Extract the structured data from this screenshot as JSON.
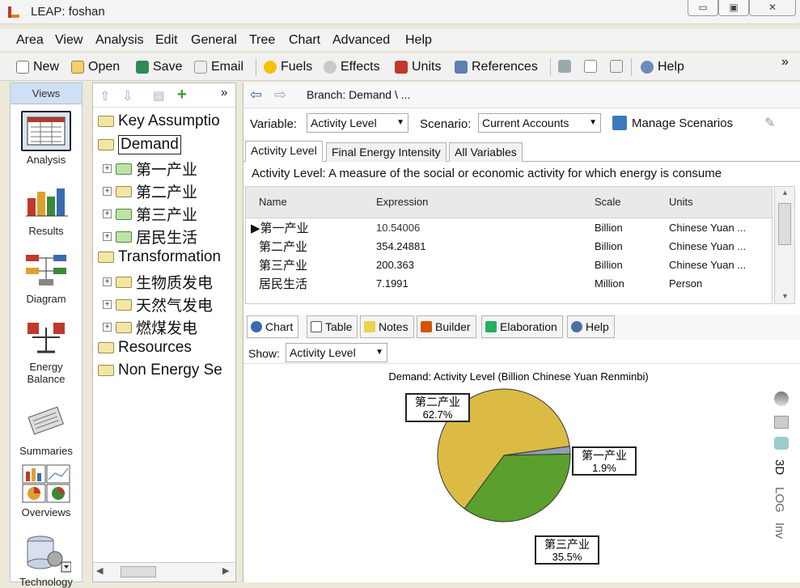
{
  "window": {
    "title": "LEAP: foshan",
    "buttons": [
      "▭",
      "▣",
      "✕"
    ]
  },
  "menu": [
    "Area",
    "View",
    "Analysis",
    "Edit",
    "General",
    "Tree",
    "Chart",
    "Advanced",
    "Help"
  ],
  "toolbar": {
    "new": "New",
    "open": "Open",
    "save": "Save",
    "email": "Email",
    "fuels": "Fuels",
    "effects": "Effects",
    "units": "Units",
    "references": "References",
    "help": "Help",
    "more": "»"
  },
  "views": {
    "header": "Views",
    "items": [
      "Analysis",
      "Results",
      "Diagram",
      "Energy Balance",
      "Summaries",
      "Overviews",
      "Technology"
    ]
  },
  "tree": {
    "more": "»",
    "nodes": [
      {
        "label": "Key Assumptio"
      },
      {
        "label": "Demand"
      },
      {
        "label": "第一产业"
      },
      {
        "label": "第二产业"
      },
      {
        "label": "第三产业"
      },
      {
        "label": "居民生活"
      },
      {
        "label": "Transformation"
      },
      {
        "label": "生物质发电"
      },
      {
        "label": "天然气发电"
      },
      {
        "label": "燃煤发电"
      },
      {
        "label": "Resources"
      },
      {
        "label": "Non Energy Se"
      }
    ]
  },
  "branch": {
    "label": "Branch: Demand \\ ..."
  },
  "variable": {
    "label": "Variable:",
    "value": "Activity Level"
  },
  "scenario": {
    "label": "Scenario:",
    "value": "Current Accounts",
    "manage": "Manage Scenarios"
  },
  "tabs": [
    "Activity Level",
    "Final Energy Intensity",
    "All Variables"
  ],
  "description": "Activity Level: A measure of the social or economic activity for which energy is consume",
  "table": {
    "headers": [
      "Name",
      "Expression",
      "Scale",
      "Units"
    ],
    "rows": [
      [
        "第一产业",
        "10.54006",
        "Billion",
        "Chinese Yuan ..."
      ],
      [
        "第二产业",
        "354.24881",
        "Billion",
        "Chinese Yuan ..."
      ],
      [
        "第三产业",
        "200.363",
        "Billion",
        "Chinese Yuan ..."
      ],
      [
        "居民生活",
        "7.1991",
        "Million",
        "Person"
      ]
    ]
  },
  "bottom_tabs": [
    "Chart",
    "Table",
    "Notes",
    "Builder",
    "Elaboration",
    "Help"
  ],
  "show": {
    "label": "Show:",
    "value": "Activity Level"
  },
  "side_controls": [
    "3D",
    "LOG",
    "Inv"
  ],
  "chart_data": {
    "type": "pie",
    "title": "Demand: Activity Level (Billion Chinese Yuan Renminbi)",
    "categories": [
      "第一产业",
      "第二产业",
      "第三产业"
    ],
    "values": [
      1.9,
      62.7,
      35.5
    ],
    "value_labels": [
      "1.9%",
      "62.7%",
      "35.5%"
    ],
    "colors": [
      "#8ea0b6",
      "#dcbb45",
      "#5b9f2d"
    ]
  },
  "colors": {
    "accent": "#cfe0f5",
    "selected_tab": "#ffffff"
  }
}
